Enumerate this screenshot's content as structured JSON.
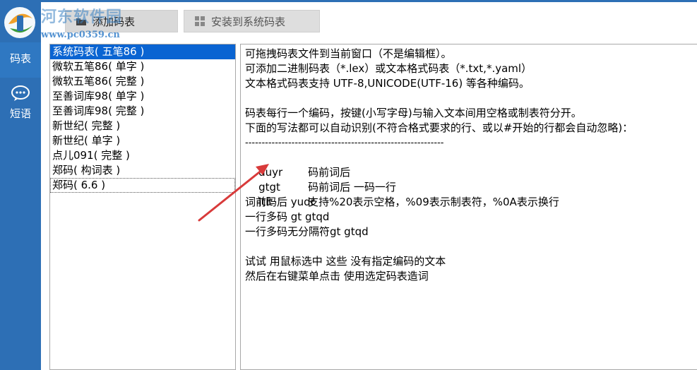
{
  "watermark": {
    "site_name": "河东软件园",
    "url": "www.pc0359.cn"
  },
  "toolbar": {
    "add_label": "添加码表",
    "install_label": "安装到系统码表"
  },
  "sidebar": {
    "items": [
      {
        "label": "码表",
        "icon": "table-icon"
      },
      {
        "label": "短语",
        "icon": "chat-bubble-icon"
      }
    ]
  },
  "code_tables": [
    "系统码表( 五笔86 )",
    "微软五笔86( 单字 )",
    "微软五笔86( 完整 )",
    "至善词库98( 单字 )",
    "至善词库98( 完整 )",
    "新世纪( 完整 )",
    "新世纪( 单字 )",
    "点儿091( 完整 )",
    "郑码( 构词表 )",
    "郑码( 6.6 )"
  ],
  "instructions": {
    "lines": [
      "可拖拽码表文件到当前窗口（不是编辑框）。",
      "可添加二进制码表（*.lex）或文本格式码表（*.txt,*.yaml）",
      "文本格式码表支持 UTF-8,UNICODE(UTF-16) 等各种编码。",
      "",
      "码表每行一个编码，按键(小写字母)与输入文本间用空格或制表符分开。",
      "下面的写法都可以自动识别(不符合格式要求的行、或以#开始的行都会自动忽略)：",
      "------------------------------------------------------------"
    ],
    "examples": [
      {
        "code": "duyr",
        "text": "码前词后"
      },
      {
        "code": "gtgt",
        "text": "码前词后 一码一行"
      },
      {
        "code": "ltlt",
        "text": "支持%20表示空格，%09表示制表符，%0A表示换行"
      }
    ],
    "tail_lines": [
      "词前码后 yudr",
      "一行多码 gt gtqd",
      "一行多码无分隔符gt gtqd",
      "",
      "试试 用鼠标选中 这些 没有指定编码的文本",
      "然后在右键菜单点击 使用选定码表造词"
    ]
  },
  "colors": {
    "rail": "#2d6fb5",
    "selection": "#0a64d2",
    "arrow": "#d83a3a"
  }
}
